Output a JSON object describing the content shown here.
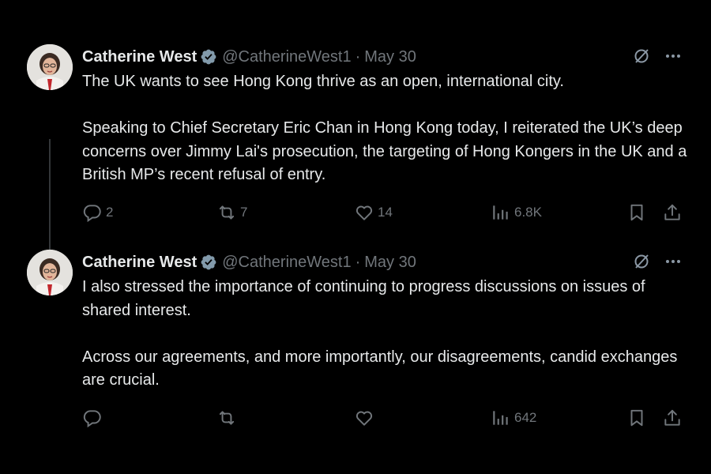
{
  "tweets": [
    {
      "author": {
        "name": "Catherine West",
        "handle": "@CatherineWest1",
        "verified": true
      },
      "separator": "·",
      "date": "May 30",
      "paragraphs": [
        "The UK wants to see Hong Kong thrive as an open, international city.",
        "Speaking to Chief Secretary Eric Chan in Hong Kong today, I reiterated the UK’s deep concerns over Jimmy Lai's prosecution, the targeting of Hong Kongers in the UK and a British MP’s recent refusal of entry."
      ],
      "stats": {
        "replies": "2",
        "reposts": "7",
        "likes": "14",
        "views": "6.8K"
      }
    },
    {
      "author": {
        "name": "Catherine West",
        "handle": "@CatherineWest1",
        "verified": true
      },
      "separator": "·",
      "date": "May 30",
      "paragraphs": [
        "I also stressed the importance of continuing to progress discussions on issues of shared interest.",
        "Across our agreements, and more importantly, our disagreements, candid exchanges are crucial."
      ],
      "stats": {
        "replies": "",
        "reposts": "",
        "likes": "",
        "views": "642"
      }
    }
  ],
  "icons": [
    "avatar-photo",
    "verified-badge-icon",
    "grok-icon",
    "more-icon",
    "reply-icon",
    "repost-icon",
    "like-icon",
    "views-icon",
    "bookmark-icon",
    "share-icon"
  ],
  "colors": {
    "background": "#000000",
    "text": "#e7e9ea",
    "muted": "#71767b",
    "verified": "#829aab"
  }
}
